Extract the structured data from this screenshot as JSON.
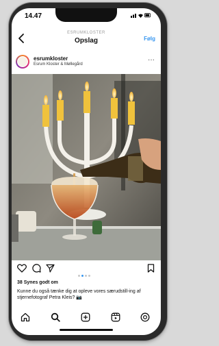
{
  "status_bar": {
    "time": "14.47",
    "icons": "▮▮▮ ● ▭"
  },
  "header": {
    "account_label": "ESRUMKLOSTER",
    "title": "Opslag",
    "back_icon": "chevron-left-icon",
    "follow_label": "Følg"
  },
  "post": {
    "username": "esrumkloster",
    "location": "Esrum Kloster & Møllegård",
    "more_label": "···",
    "likes": "38 Synes godt om",
    "caption": "Kunne du også tænke dig at opleve vores særudstill-ing af stjernefotograf Petra Kleis? 📷",
    "carousel": {
      "count": 4,
      "active": 1
    }
  },
  "icons": {
    "like": "heart-icon",
    "comment": "comment-icon",
    "share": "send-icon",
    "save": "bookmark-icon"
  },
  "bottom_nav": [
    "home-icon",
    "search-icon",
    "add-post-icon",
    "reels-icon",
    "profile-icon"
  ],
  "colors": {
    "accent": "#3897f0",
    "text": "#111111",
    "muted": "#9a9a9a"
  }
}
